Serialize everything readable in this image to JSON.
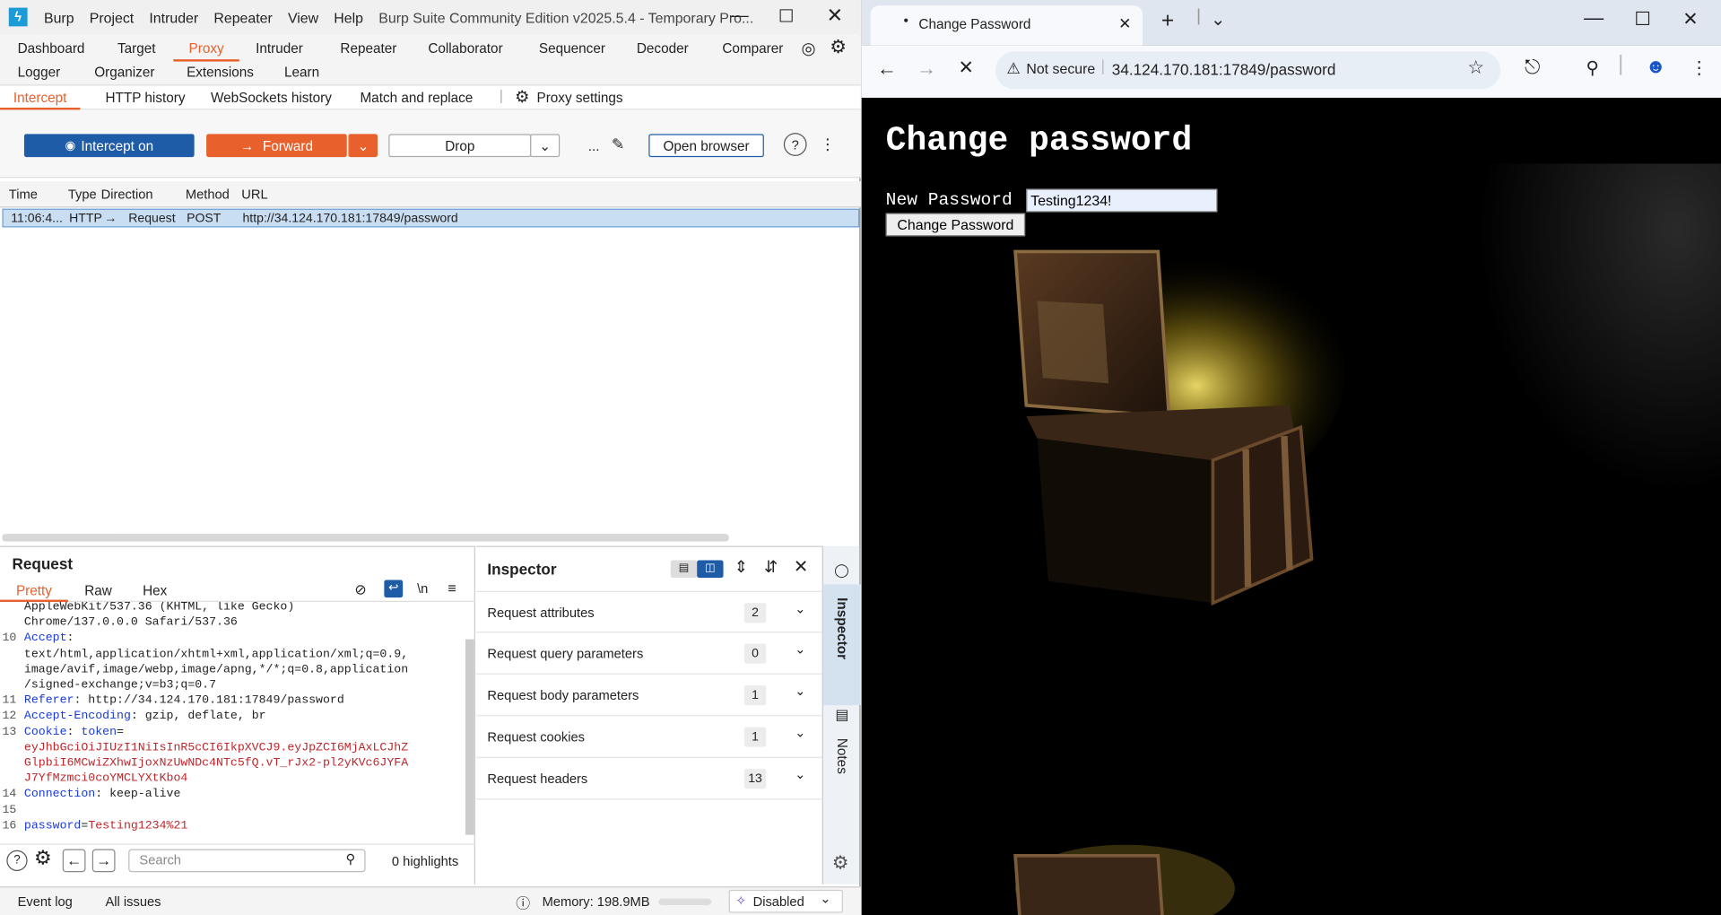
{
  "burp": {
    "menu": [
      "Burp",
      "Project",
      "Intruder",
      "Repeater",
      "View",
      "Help"
    ],
    "window_title": "Burp Suite Community Edition v2025.5.4 - Temporary Pro...",
    "tabs_row1": [
      "Dashboard",
      "Target",
      "Proxy",
      "Intruder",
      "Repeater",
      "Collaborator",
      "Sequencer",
      "Decoder",
      "Comparer"
    ],
    "tabs_row2": [
      "Logger",
      "Organizer",
      "Extensions",
      "Learn"
    ],
    "active_tab": "Proxy",
    "proxy_subtabs": [
      "Intercept",
      "HTTP history",
      "WebSockets history",
      "Match and replace"
    ],
    "proxy_settings": "Proxy settings",
    "toolbar": {
      "intercept_on": "Intercept on",
      "forward": "Forward",
      "drop": "Drop",
      "more": "...",
      "open_browser": "Open browser"
    },
    "grid": {
      "headers": [
        "Time",
        "Type",
        "Direction",
        "Method",
        "URL"
      ],
      "row": {
        "time": "11:06:4...",
        "type": "HTTP",
        "arrow": "→",
        "direction": "Request",
        "method": "POST",
        "url": "http://34.124.170.181:17849/password"
      }
    },
    "request": {
      "title": "Request",
      "tabs": [
        "Pretty",
        "Raw",
        "Hex"
      ],
      "newline_toggle": "\\n",
      "lines": [
        {
          "n": "",
          "parts": [
            {
              "t": "AppleWebKit/537.36 (KHTML, like Gecko)",
              "c": "v"
            }
          ]
        },
        {
          "n": "",
          "parts": [
            {
              "t": "Chrome/137.0.0.0 Safari/537.36",
              "c": "v"
            }
          ]
        },
        {
          "n": "10",
          "parts": [
            {
              "t": "Accept",
              "c": "k"
            },
            {
              "t": ":",
              "c": "v"
            }
          ]
        },
        {
          "n": "",
          "parts": [
            {
              "t": "text/html,application/xhtml+xml,application/xml;q=0.9,",
              "c": "v"
            }
          ]
        },
        {
          "n": "",
          "parts": [
            {
              "t": "image/avif,image/webp,image/apng,*/*;q=0.8,application",
              "c": "v"
            }
          ]
        },
        {
          "n": "",
          "parts": [
            {
              "t": "/signed-exchange;v=b3;q=0.7",
              "c": "v"
            }
          ]
        },
        {
          "n": "11",
          "parts": [
            {
              "t": "Referer",
              "c": "k"
            },
            {
              "t": ": http://34.124.170.181:17849/password",
              "c": "v"
            }
          ]
        },
        {
          "n": "12",
          "parts": [
            {
              "t": "Accept-Encoding",
              "c": "k"
            },
            {
              "t": ": gzip, deflate, br",
              "c": "v"
            }
          ]
        },
        {
          "n": "13",
          "parts": [
            {
              "t": "Cookie",
              "c": "k"
            },
            {
              "t": ": ",
              "c": "v"
            },
            {
              "t": "token",
              "c": "k"
            },
            {
              "t": "=",
              "c": "v"
            }
          ]
        },
        {
          "n": "",
          "parts": [
            {
              "t": "eyJhbGciOiJIUzI1NiIsInR5cCI6IkpXVCJ9.eyJpZCI6MjAxLCJhZ",
              "c": "r"
            }
          ]
        },
        {
          "n": "",
          "parts": [
            {
              "t": "GlpbiI6MCwiZXhwIjoxNzUwNDc4NTc5fQ.vT_rJx2-pl2yKVc6JYFA",
              "c": "r"
            }
          ]
        },
        {
          "n": "",
          "parts": [
            {
              "t": "J7YfMzmci0coYMCLYXtKbo4",
              "c": "r"
            }
          ]
        },
        {
          "n": "14",
          "parts": [
            {
              "t": "Connection",
              "c": "k"
            },
            {
              "t": ": keep-alive",
              "c": "v"
            }
          ]
        },
        {
          "n": "15",
          "parts": []
        },
        {
          "n": "16",
          "parts": [
            {
              "t": "password",
              "c": "k"
            },
            {
              "t": "=",
              "c": "v"
            },
            {
              "t": "Testing1234%21",
              "c": "r"
            }
          ]
        }
      ],
      "search_placeholder": "Search",
      "highlights": "0 highlights"
    },
    "inspector": {
      "title": "Inspector",
      "rows": [
        {
          "label": "Request attributes",
          "count": "2"
        },
        {
          "label": "Request query parameters",
          "count": "0"
        },
        {
          "label": "Request body parameters",
          "count": "1"
        },
        {
          "label": "Request cookies",
          "count": "1"
        },
        {
          "label": "Request headers",
          "count": "13"
        }
      ]
    },
    "side_tabs": [
      "Inspector",
      "Notes"
    ],
    "status": {
      "event_log": "Event log",
      "all_issues": "All issues",
      "memory": "Memory: 198.9MB",
      "disabled": "Disabled"
    }
  },
  "chrome": {
    "tab_title": "Change Password",
    "security": "Not secure",
    "url": "34.124.170.181:17849/password",
    "page": {
      "heading": "Change password",
      "label": "New Password",
      "input_value": "Testing1234!",
      "button": "Change Password"
    }
  },
  "colors": {
    "accent": "#e8602c",
    "intercept_blue": "#1f5ca8",
    "burp_logo": "#1c9bd6"
  }
}
